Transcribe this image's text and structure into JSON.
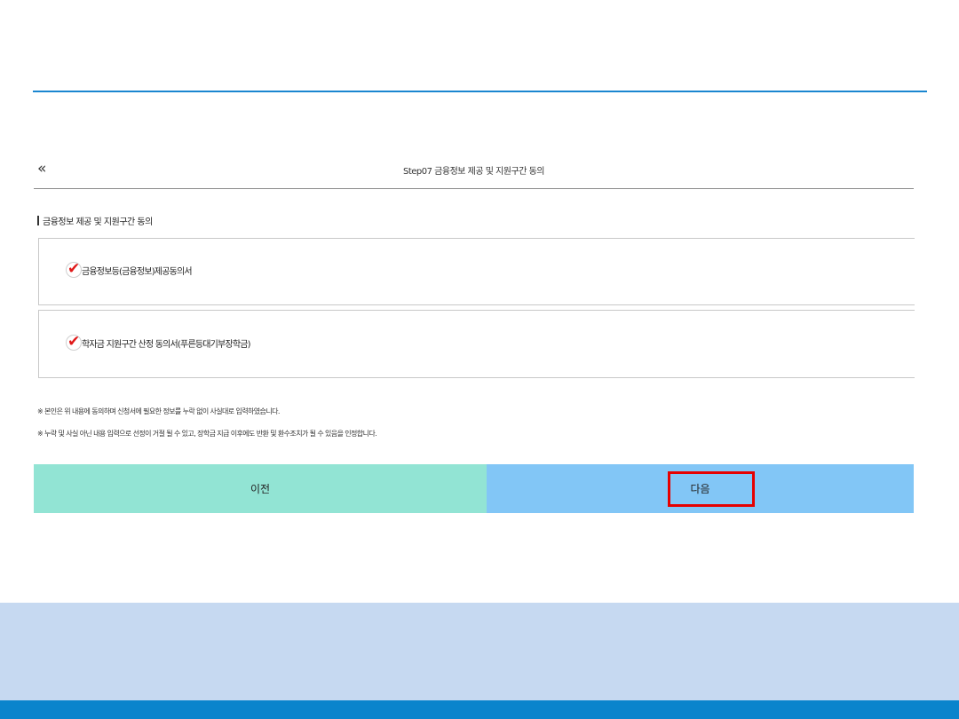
{
  "header": {
    "back_icon": "«",
    "step_title": "Step07 금융정보 제공 및 지원구간 동의"
  },
  "section": {
    "title": "금융정보 제공 및 지원구간 동의"
  },
  "agreements": [
    {
      "label": "금융정보등(금융정보)제공동의서",
      "checked": true
    },
    {
      "label": "학자금 지원구간 산정 동의서(푸른등대기부장학금)",
      "checked": true
    }
  ],
  "check_icon": "✔",
  "notices": [
    "※ 본인은 위 내용에 동의하며 신청서에 필요한 정보를 누락 없이 사실대로 입력하였습니다.",
    "※ 누락 및 사실 아닌 내용 입력으로 선정이 거절 될 수 있고, 장학금 지급 이후에도 반환 및 환수조치가 될 수 있음을 인정합니다."
  ],
  "buttons": {
    "prev": "이전",
    "next": "다음"
  },
  "colors": {
    "prev_bg": "#92e4d4",
    "next_bg": "#82c6f6",
    "highlight": "#e60000",
    "accent": "#1a86d0"
  }
}
